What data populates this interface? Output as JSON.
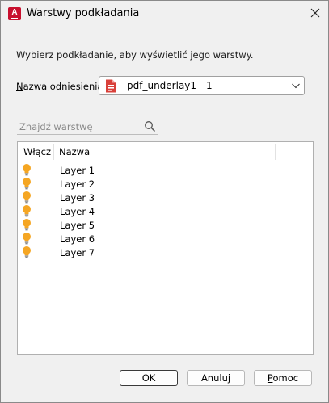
{
  "window": {
    "title": "Warstwy podkładania",
    "app_icon_letter": "A"
  },
  "instruction": "Wybierz podkładanie, aby wyświetlić jego warstwy.",
  "reference": {
    "label_mnemonic": "N",
    "label_rest": "azwa odniesienia:",
    "selected": "pdf_underlay1 - 1",
    "icon": "pdf-file-icon"
  },
  "search": {
    "placeholder": "Znajdź warstwę",
    "icon": "search-icon"
  },
  "table": {
    "columns": [
      "Włącz",
      "Nazwa"
    ],
    "rows": [
      {
        "on": true,
        "name": "Layer 1"
      },
      {
        "on": true,
        "name": "Layer 2"
      },
      {
        "on": true,
        "name": "Layer 3"
      },
      {
        "on": true,
        "name": "Layer 4"
      },
      {
        "on": true,
        "name": "Layer 5"
      },
      {
        "on": true,
        "name": "Layer 6"
      },
      {
        "on": true,
        "name": "Layer 7"
      }
    ],
    "bulb_color": "#f5a623"
  },
  "buttons": {
    "ok": "OK",
    "cancel": "Anuluj",
    "help_mnemonic": "P",
    "help_rest": "omoc"
  }
}
